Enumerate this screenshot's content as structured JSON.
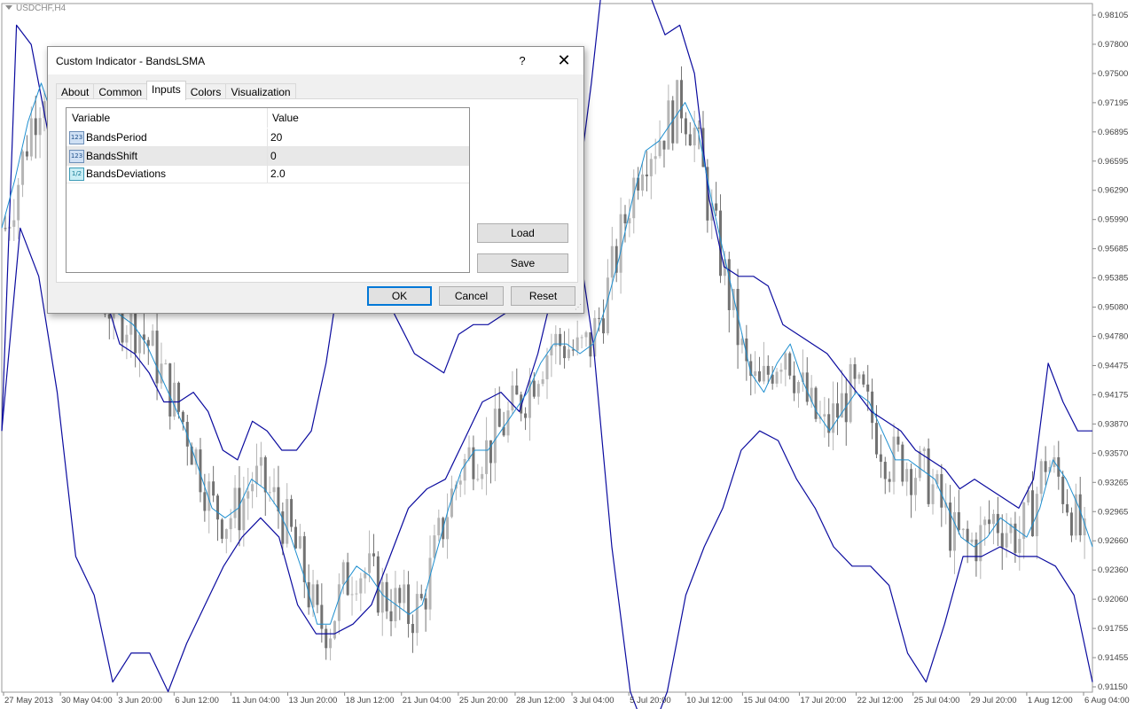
{
  "chart": {
    "symbol": "USDCHF,H4",
    "colors": {
      "band": "#0b0b9f",
      "middle": "#1e8fd0",
      "candle_up": "#b5b5b5",
      "candle_down": "#727272",
      "grid_axis": "#8a8a8a"
    },
    "y_range": [
      0.9115,
      0.9815
    ],
    "price_ticks": [
      "0.98105",
      "0.97800",
      "0.97500",
      "0.97195",
      "0.96895",
      "0.96595",
      "0.96290",
      "0.95990",
      "0.95685",
      "0.95385",
      "0.95080",
      "0.94780",
      "0.94475",
      "0.94175",
      "0.93870",
      "0.93570",
      "0.93265",
      "0.92965",
      "0.92660",
      "0.92360",
      "0.92060",
      "0.91755",
      "0.91455",
      "0.91150"
    ],
    "date_ticks": [
      "27 May 2013",
      "30 May 04:00",
      "3 Jun 20:00",
      "6 Jun 12:00",
      "11 Jun 04:00",
      "13 Jun 20:00",
      "18 Jun 12:00",
      "21 Jun 04:00",
      "25 Jun 20:00",
      "28 Jun 12:00",
      "3 Jul 04:00",
      "5 Jul 20:00",
      "10 Jul 12:00",
      "15 Jul 04:00",
      "17 Jul 20:00",
      "22 Jul 12:00",
      "25 Jul 04:00",
      "29 Jul 20:00",
      "1 Aug 12:00",
      "6 Aug 04:00"
    ],
    "middle_line": [
      0.959,
      0.964,
      0.97,
      0.974,
      0.97,
      0.96,
      0.956,
      0.953,
      0.951,
      0.95,
      0.949,
      0.947,
      0.944,
      0.941,
      0.938,
      0.934,
      0.93,
      0.929,
      0.93,
      0.933,
      0.932,
      0.93,
      0.927,
      0.923,
      0.918,
      0.918,
      0.922,
      0.924,
      0.923,
      0.921,
      0.92,
      0.919,
      0.92,
      0.925,
      0.93,
      0.934,
      0.936,
      0.936,
      0.938,
      0.94,
      0.942,
      0.945,
      0.947,
      0.947,
      0.946,
      0.947,
      0.951,
      0.956,
      0.962,
      0.967,
      0.968,
      0.97,
      0.972,
      0.969,
      0.962,
      0.956,
      0.95,
      0.944,
      0.942,
      0.945,
      0.947,
      0.943,
      0.94,
      0.938,
      0.94,
      0.942,
      0.941,
      0.938,
      0.935,
      0.935,
      0.934,
      0.933,
      0.93,
      0.927,
      0.926,
      0.927,
      0.929,
      0.928,
      0.927,
      0.93,
      0.935,
      0.933,
      0.93,
      0.926
    ],
    "upper_band": [
      0.938,
      0.98,
      0.978,
      0.97,
      0.962,
      0.961,
      0.958,
      0.952,
      0.947,
      0.946,
      0.944,
      0.941,
      0.941,
      0.942,
      0.94,
      0.936,
      0.935,
      0.939,
      0.938,
      0.936,
      0.936,
      0.938,
      0.945,
      0.955,
      0.959,
      0.96,
      0.952,
      0.949,
      0.946,
      0.945,
      0.944,
      0.948,
      0.949,
      0.949,
      0.95,
      0.951,
      0.951,
      0.955,
      0.956,
      0.962,
      0.974,
      0.988,
      0.992,
      0.989,
      0.983,
      0.979,
      0.98,
      0.975,
      0.962,
      0.955,
      0.954,
      0.954,
      0.953,
      0.949,
      0.948,
      0.947,
      0.946,
      0.944,
      0.942,
      0.94,
      0.939,
      0.938,
      0.936,
      0.935,
      0.934,
      0.932,
      0.933,
      0.932,
      0.931,
      0.93,
      0.933,
      0.945,
      0.941,
      0.938,
      0.938
    ],
    "lower_band": [
      0.938,
      0.959,
      0.954,
      0.942,
      0.925,
      0.921,
      0.912,
      0.915,
      0.915,
      0.911,
      0.916,
      0.92,
      0.924,
      0.927,
      0.929,
      0.927,
      0.92,
      0.917,
      0.917,
      0.918,
      0.92,
      0.925,
      0.93,
      0.932,
      0.933,
      0.937,
      0.941,
      0.942,
      0.94,
      0.946,
      0.954,
      0.96,
      0.947,
      0.926,
      0.911,
      0.906,
      0.911,
      0.921,
      0.926,
      0.93,
      0.936,
      0.938,
      0.937,
      0.933,
      0.93,
      0.926,
      0.924,
      0.924,
      0.922,
      0.915,
      0.912,
      0.918,
      0.925,
      0.925,
      0.926,
      0.925,
      0.925,
      0.924,
      0.921,
      0.912
    ]
  },
  "dialog": {
    "title": "Custom Indicator - BandsLSMA",
    "help_symbol": "?",
    "close_symbol": "✕",
    "tabs": [
      "About",
      "Common",
      "Inputs",
      "Colors",
      "Visualization"
    ],
    "active_tab": "Inputs",
    "grid": {
      "col_variable": "Variable",
      "col_value": "Value",
      "rows": [
        {
          "icon": "123",
          "name": "BandsPeriod",
          "value": "20"
        },
        {
          "icon": "123",
          "name": "BandsShift",
          "value": "0"
        },
        {
          "icon": "1/2",
          "name": "BandsDeviations",
          "value": "2.0"
        }
      ]
    },
    "buttons": {
      "load": "Load",
      "save": "Save",
      "ok": "OK",
      "cancel": "Cancel",
      "reset": "Reset"
    }
  }
}
